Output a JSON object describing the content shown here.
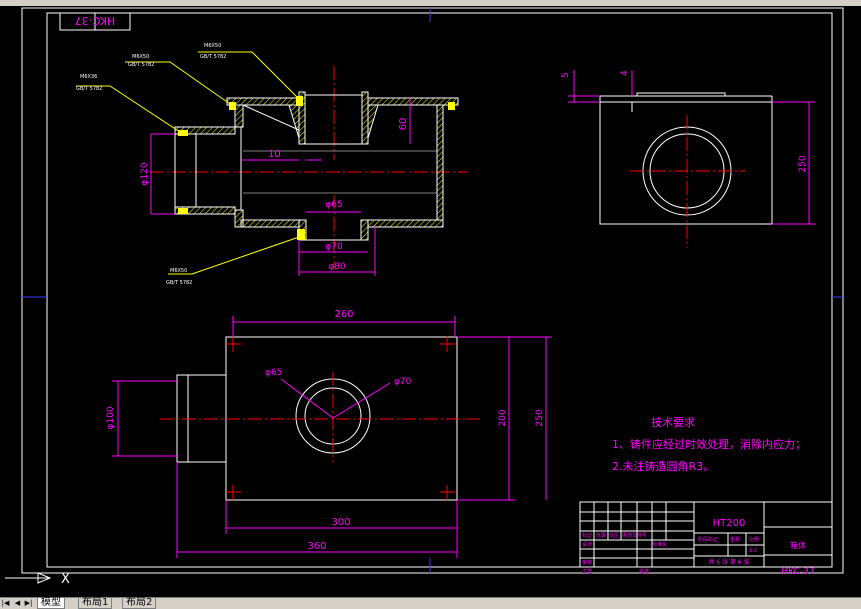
{
  "drawing": {
    "title_box_text": "HKC-37",
    "notes_title": "技术要求",
    "notes": [
      "1、铸件应经过时效处理，消除内应力；",
      "2.未注铸造圆角R3。"
    ],
    "callouts": [
      {
        "line1": "M6X50",
        "line2": "GB/T 5782"
      },
      {
        "line1": "M6X50",
        "line2": "GB/T 5782"
      },
      {
        "line1": "M6X36",
        "line2": "GB/T 5782"
      },
      {
        "line1": "M6X50",
        "line2": "GB/T 5782"
      }
    ],
    "dims": {
      "front_wall": "10",
      "front_height": "60",
      "front_d120": "φ120",
      "front_d65": "φ65",
      "front_d70": "φ70",
      "front_d80": "φ80",
      "side_5": "5",
      "side_4": "4",
      "side_250": "250",
      "top_260": "260",
      "top_d65": "φ65",
      "top_d70": "φ70",
      "top_d100": "φ100",
      "top_200": "200",
      "top_250": "250",
      "top_300": "300",
      "top_360": "360"
    },
    "title_block": {
      "material": "HT200",
      "part_name": "箱体",
      "drawing_no": "HKC-37",
      "scale_label": "比例",
      "scale_value": "1:2",
      "sheet_text": "共 6 张 第 6 张",
      "cells": [
        "标记",
        "处数",
        "分区",
        "更改文件号",
        "设计",
        "标准化",
        "审核",
        "工艺",
        "批准",
        "阶段标记",
        "重量"
      ]
    }
  },
  "ucs_label": "X",
  "tabs": {
    "model": "模型",
    "layout1": "布局1",
    "layout2": "布局2"
  },
  "colors": {
    "background": "#000000",
    "frame": "#ffffff",
    "section_hatch": "#ffff00",
    "centerline": "#ff0000",
    "dimension": "#ff00ff",
    "title_text": "#ff00ff"
  }
}
